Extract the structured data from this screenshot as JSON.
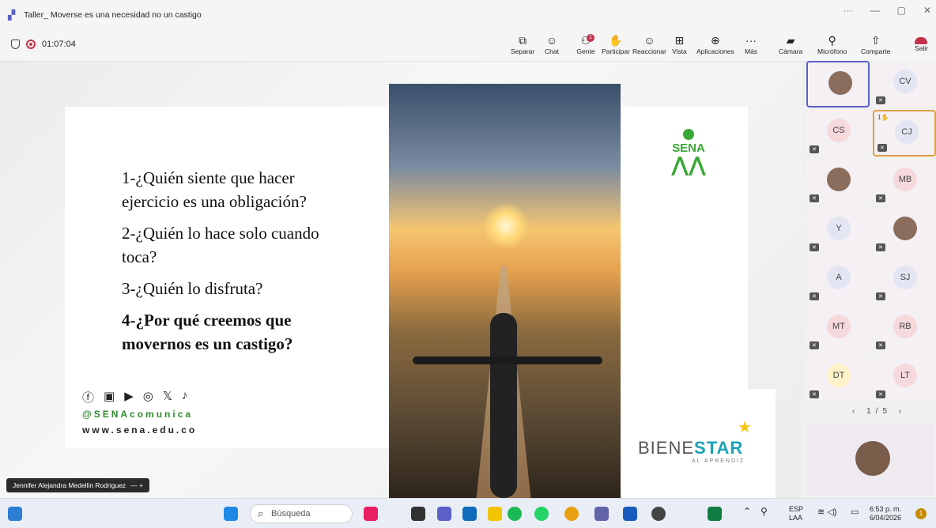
{
  "window": {
    "title": "Taller_ Moverse es una necesidad no un castigo",
    "controls": [
      "···",
      "—",
      "▢",
      "✕"
    ]
  },
  "meeting": {
    "timer": "01:07:04",
    "toolbar": [
      {
        "label": "Separar",
        "icon": "popout-icon"
      },
      {
        "label": "Chat",
        "icon": "chat-icon"
      },
      {
        "label": "Gente",
        "icon": "people-icon",
        "badge": "1"
      },
      {
        "label": "Participar",
        "icon": "raise-hand-icon"
      },
      {
        "label": "Reaccionar",
        "icon": "react-icon"
      },
      {
        "label": "Vista",
        "icon": "view-icon"
      },
      {
        "label": "Aplicaciones",
        "icon": "apps-icon"
      },
      {
        "label": "Más",
        "icon": "more-icon"
      },
      {
        "label": "Cámara",
        "icon": "camera-off-icon"
      },
      {
        "label": "Micrófono",
        "icon": "mic-off-icon"
      },
      {
        "label": "Comparte",
        "icon": "share-icon"
      }
    ],
    "leave_label": "Salir"
  },
  "slide": {
    "questions": [
      "1-¿Quién siente que hacer",
      "ejercicio es una obligación?",
      "2-¿Quién lo hace solo cuando",
      "toca?",
      "3-¿Quién lo disfruta?",
      "4-¿Por qué creemos que",
      "movernos es un castigo?"
    ],
    "social_icons": [
      "facebook-icon",
      "linkedin-icon",
      "youtube-icon",
      "instagram-icon",
      "x-icon",
      "tiktok-icon"
    ],
    "handle": "@SENAcomunica",
    "website": "www.sena.edu.co",
    "sena_text": "SENA",
    "bienestar": {
      "prefix": "BIENE",
      "suffix": "STAR",
      "sub": "AL APRENDIZ"
    }
  },
  "presenter_name": "Jennifer Alejandra Medellin Rodriguez",
  "participants": [
    {
      "initials": "",
      "photo": true
    },
    {
      "initials": "CV",
      "color": "#e3e6f2"
    },
    {
      "initials": "CS",
      "color": "#f6d9dc"
    },
    {
      "initials": "CJ",
      "color": "#e3e6f2",
      "hand": "1"
    },
    {
      "initials": "",
      "photo": true
    },
    {
      "initials": "MB",
      "color": "#f6d9dc"
    },
    {
      "initials": "Y",
      "color": "#e3e6f2"
    },
    {
      "initials": "",
      "photo": true
    },
    {
      "initials": "A",
      "color": "#e3e6f2"
    },
    {
      "initials": "SJ",
      "color": "#e3e6f2"
    },
    {
      "initials": "MT",
      "color": "#f6d9dc"
    },
    {
      "initials": "RB",
      "color": "#f6d9dc"
    },
    {
      "initials": "DT",
      "color": "#fff2c9"
    },
    {
      "initials": "LT",
      "color": "#f6d9dc"
    }
  ],
  "pager": "1/5",
  "taskbar": {
    "search_placeholder": "Búsqueda",
    "lang_top": "ESP",
    "lang_bottom": "LAA",
    "time": "6:53 p. m.",
    "date": "6/04/2026",
    "notifications": "1"
  }
}
